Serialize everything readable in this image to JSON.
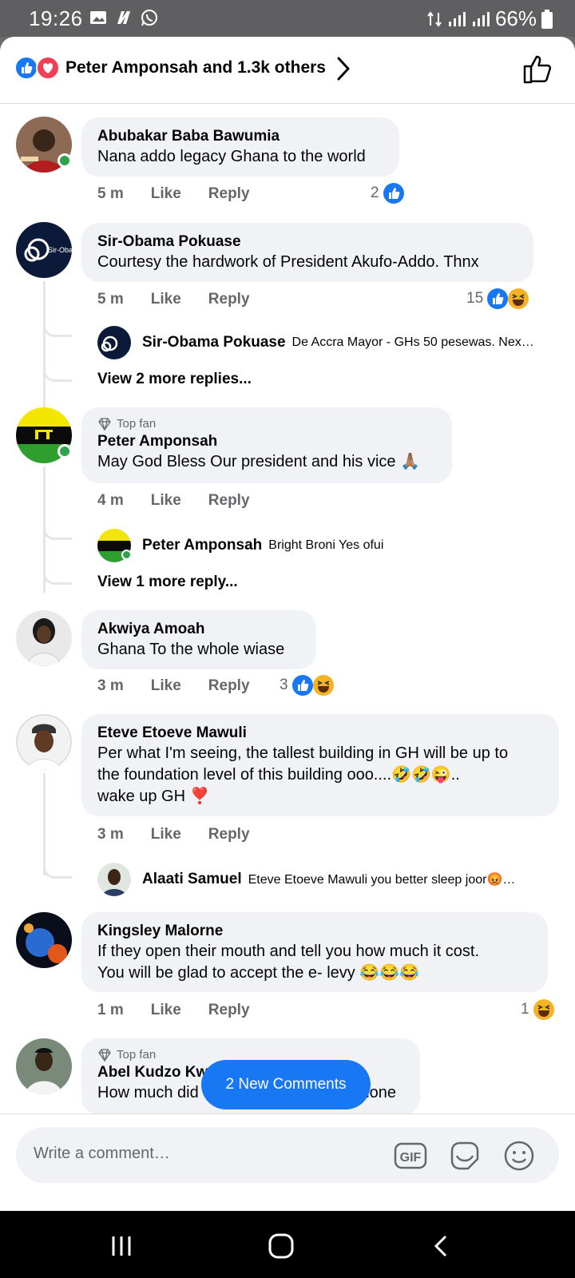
{
  "status": {
    "time": "19:26",
    "battery": "66%"
  },
  "header": {
    "title": "Peter Amponsah and 1.3k others"
  },
  "comments": [
    {
      "name": "Abubakar Baba Bawumia",
      "text": "Nana addo legacy Ghana to the world",
      "time": "5 m",
      "like": "Like",
      "reply": "Reply",
      "react_count": "2"
    },
    {
      "name": "Sir-Obama Pokuase",
      "text": "Courtesy the hardwork of President Akufo-Addo. Thnx",
      "time": "5 m",
      "like": "Like",
      "reply": "Reply",
      "react_count": "15",
      "reply_preview": {
        "name": "Sir-Obama Pokuase",
        "text": "De Accra Mayor - GHs 50 pesewas. Nex…"
      },
      "view_more": "View 2 more replies..."
    },
    {
      "badge": "Top fan",
      "name": "Peter Amponsah",
      "text": "May God Bless Our president and his vice 🙏🏽",
      "time": "4 m",
      "like": "Like",
      "reply": "Reply",
      "reply_preview": {
        "name": "Peter Amponsah",
        "text": "Bright Broni Yes ofui"
      },
      "view_more": "View 1 more reply..."
    },
    {
      "name": "Akwiya Amoah",
      "text": "Ghana To the whole wiase",
      "time": "3 m",
      "like": "Like",
      "reply": "Reply",
      "react_count": "3"
    },
    {
      "name": "Eteve Etoeve Mawuli",
      "text_lines": [
        "Per what I'm seeing, the tallest building in GH will be up to",
        "the foundation level of this building ooo....🤣🤣😜..",
        "wake up GH ❣️"
      ],
      "time": "3 m",
      "like": "Like",
      "reply": "Reply",
      "reply_preview": {
        "name": "Alaati Samuel",
        "text": "Eteve Etoeve Mawuli you better sleep joor😡…"
      }
    },
    {
      "name": "Kingsley Malorne",
      "text_lines": [
        "If they open their mouth and tell you how much it cost.",
        "You will be glad to accept the e- levy 😂😂😂"
      ],
      "time": "1 m",
      "like": "Like",
      "reply": "Reply",
      "react_count": "1"
    },
    {
      "badge": "Top fan",
      "name": "Abel Kudzo Kwa",
      "text_start": "How much did",
      "text_end": "done"
    }
  ],
  "new_comments": "2 New Comments",
  "composer": {
    "placeholder": "Write a comment…"
  },
  "colors": {
    "accent": "#1877f2",
    "bubble": "#f0f2f5",
    "secondary_text": "#65676b",
    "love": "#f33e58",
    "haha": "#f7b125"
  },
  "icons": [
    "like-reaction-icon",
    "love-reaction-icon",
    "haha-reaction-icon",
    "chevron-right-icon",
    "thumbs-up-outline-icon",
    "diamond-icon",
    "gif-icon",
    "sticker-icon",
    "emoji-icon",
    "recent-apps-icon",
    "home-icon",
    "back-icon"
  ]
}
